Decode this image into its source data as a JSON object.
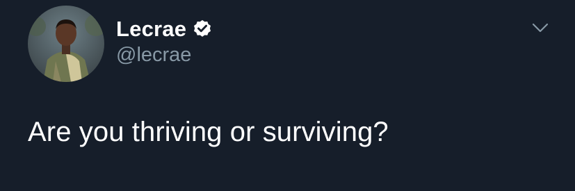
{
  "tweet": {
    "author": {
      "display_name": "Lecrae",
      "handle": "@lecrae",
      "verified": true,
      "avatar_icon": "profile-photo"
    },
    "text": "Are you thriving or surviving?",
    "menu_icon": "chevron-down-icon"
  },
  "colors": {
    "background": "#161e2a",
    "primary_text": "#ffffff",
    "secondary_text": "#8899a6",
    "caret": "#8899a6"
  }
}
